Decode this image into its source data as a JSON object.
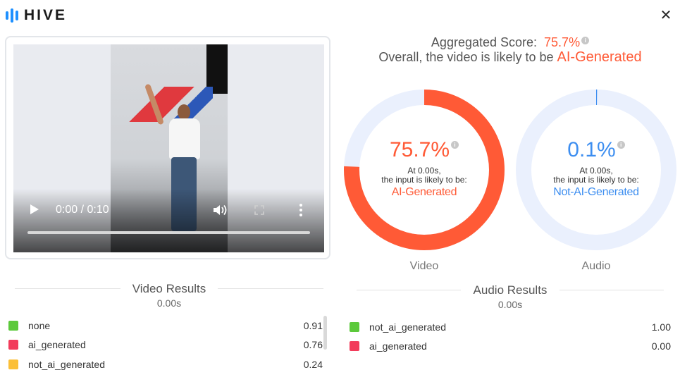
{
  "app": {
    "logo_text": "HIVE",
    "logo_icon": "hive-bars-icon",
    "close_glyph": "✕"
  },
  "video": {
    "time": "0:00 / 0:10",
    "progress_fraction": 0.0
  },
  "aggregate": {
    "label": "Aggregated Score:",
    "score": "75.7%",
    "line2_prefix": "Overall, the video is likely to be",
    "verdict": "AI-Generated",
    "info_glyph": "i"
  },
  "donuts": [
    {
      "pct_text": "75.7%",
      "fraction": 0.757,
      "note1": "At 0.00s,",
      "note2": "the input is likely to be:",
      "verdict": "AI-Generated",
      "caption": "Video",
      "color": "#ff5a36",
      "track_color": "#eaf0fd"
    },
    {
      "pct_text": "0.1%",
      "fraction": 0.001,
      "note1": "At 0.00s,",
      "note2": "the input is likely to be:",
      "verdict": "Not-AI-Generated",
      "caption": "Audio",
      "color": "#3d8ef0",
      "track_color": "#eaf0fd"
    }
  ],
  "video_results": {
    "title": "Video Results",
    "time": "0.00s",
    "rows": [
      {
        "label": "none",
        "value": "0.91",
        "color": "#5cc93b"
      },
      {
        "label": "ai_generated",
        "value": "0.76",
        "color": "#f23c5b"
      },
      {
        "label": "not_ai_generated",
        "value": "0.24",
        "color": "#fbbf37"
      }
    ]
  },
  "audio_results": {
    "title": "Audio Results",
    "time": "0.00s",
    "rows": [
      {
        "label": "not_ai_generated",
        "value": "1.00",
        "color": "#5cc93b"
      },
      {
        "label": "ai_generated",
        "value": "0.00",
        "color": "#f23c5b"
      }
    ]
  },
  "colors": {
    "accent_ai": "#ff5a36",
    "accent_not_ai": "#3d8ef0",
    "brand_blue": "#1e90ff"
  }
}
